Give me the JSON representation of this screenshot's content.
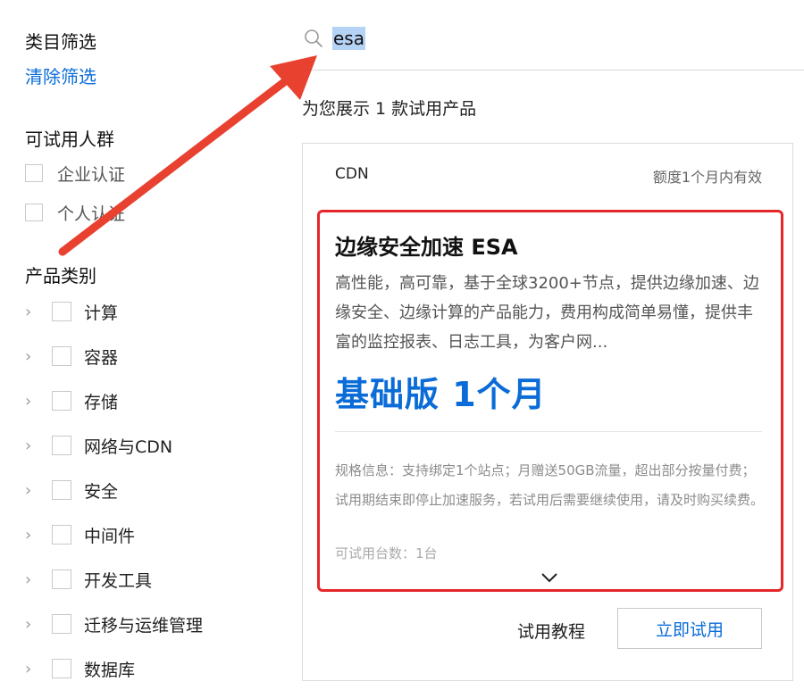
{
  "sidebar": {
    "category_filter_title": "类目筛选",
    "clear_filter": "清除筛选",
    "audience_title": "可试用人群",
    "audience_options": [
      "企业认证",
      "个人认证"
    ],
    "product_category_title": "产品类别",
    "categories": [
      "计算",
      "容器",
      "存储",
      "网络与CDN",
      "安全",
      "中间件",
      "开发工具",
      "迁移与运维管理",
      "数据库"
    ]
  },
  "search": {
    "query": "esa",
    "icon": "search-icon"
  },
  "results": {
    "count_text": "为您展示 1 款试用产品"
  },
  "card": {
    "category": "CDN",
    "validity": "额度1个月内有效",
    "title": "边缘安全加速 ESA",
    "description": "高性能，高可靠，基于全球3200+节点，提供边缘加速、边缘安全、边缘计算的产品能力，费用构成简单易懂，提供丰富的监控报表、日志工具，为客户网...",
    "plan": "基础版 1个月",
    "spec": "规格信息：支持绑定1个站点；月赠送50GB流量，超出部分按量付费；试用期结束即停止加速服务，若试用后需要继续使用，请及时购买续费。",
    "quantity": "可试用台数：1台",
    "tutorial": "试用教程",
    "try_button": "立即试用"
  },
  "colors": {
    "accent": "#0b6cd8",
    "highlight_border": "#e5262a",
    "annotation_arrow": "#e8412f"
  }
}
